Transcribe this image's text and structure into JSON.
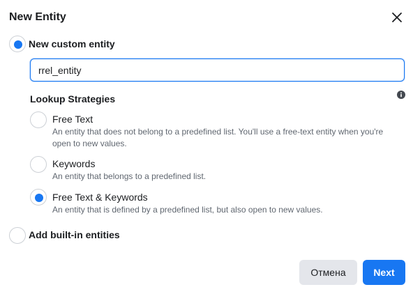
{
  "dialog": {
    "title": "New Entity"
  },
  "custom_option": {
    "label": "New custom entity",
    "selected": true
  },
  "entity_input": {
    "value": "rrel_entity",
    "placeholder": ""
  },
  "lookup": {
    "title": "Lookup Strategies",
    "info_icon": "info-icon",
    "strategies": [
      {
        "label": "Free Text",
        "description": "An entity that does not belong to a predefined list. You'll use a free-text entity when you're open to new values.",
        "selected": false
      },
      {
        "label": "Keywords",
        "description": "An entity that belongs to a predefined list.",
        "selected": false
      },
      {
        "label": "Free Text & Keywords",
        "description": "An entity that is defined by a predefined list, but also open to new values.",
        "selected": true
      }
    ]
  },
  "builtin_option": {
    "label": "Add built-in entities",
    "selected": false
  },
  "footer": {
    "cancel_label": "Отмена",
    "next_label": "Next"
  },
  "colors": {
    "accent": "#1877f2",
    "text": "#1c1e21",
    "secondary_text": "#606770",
    "cancel_bg": "#e4e6eb"
  }
}
